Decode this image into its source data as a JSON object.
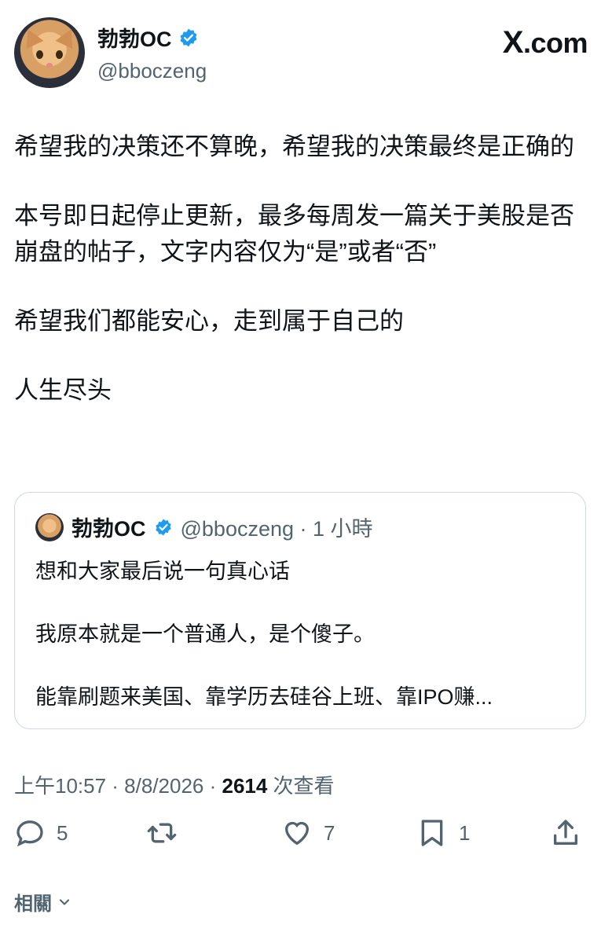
{
  "header": {
    "display_name": "勃勃OC",
    "handle": "@bboczeng",
    "site_logo": ".com",
    "site_logo_mark": "X"
  },
  "tweet": {
    "paragraphs": [
      "希望我的决策还不算晚，希望我的决策最终是正确的",
      "本号即日起停止更新，最多每周发一篇关于美股是否崩盘的帖子，文字内容仅为“是”或者“否”",
      "希望我们都能安心，走到属于自己的",
      "人生尽头"
    ]
  },
  "quote": {
    "display_name": "勃勃OC",
    "handle_time": "@bboczeng · 1 小時",
    "lines": [
      "想和大家最后说一句真心话",
      "我原本就是一个普通人，是个傻子。",
      "能靠刷题来美国、靠学历去硅谷上班、靠IPO赚..."
    ]
  },
  "meta": {
    "time_date": "上午10:57 · 8/8/2026 · ",
    "views_count": "2614",
    "views_label": " 次查看"
  },
  "actions": {
    "reply_count": "5",
    "like_count": "7",
    "bookmark_count": "1"
  },
  "related": {
    "label": "相關"
  },
  "colors": {
    "text": "#0f1419",
    "secondary": "#536471",
    "verified": "#1d9bf0",
    "border": "#cfd9de"
  }
}
